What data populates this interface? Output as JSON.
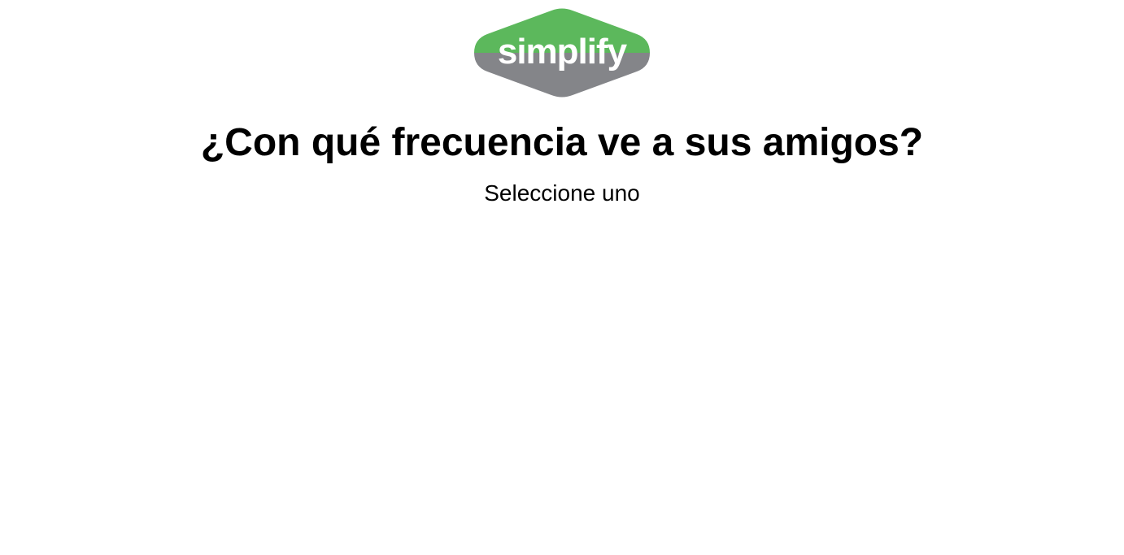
{
  "logo": {
    "text": "simplify",
    "colors": {
      "top": "#5cb85c",
      "bottom": "#848589",
      "text": "#ffffff"
    }
  },
  "survey": {
    "question": "¿Con qué frecuencia ve a sus amigos?",
    "instruction": "Seleccione uno"
  }
}
